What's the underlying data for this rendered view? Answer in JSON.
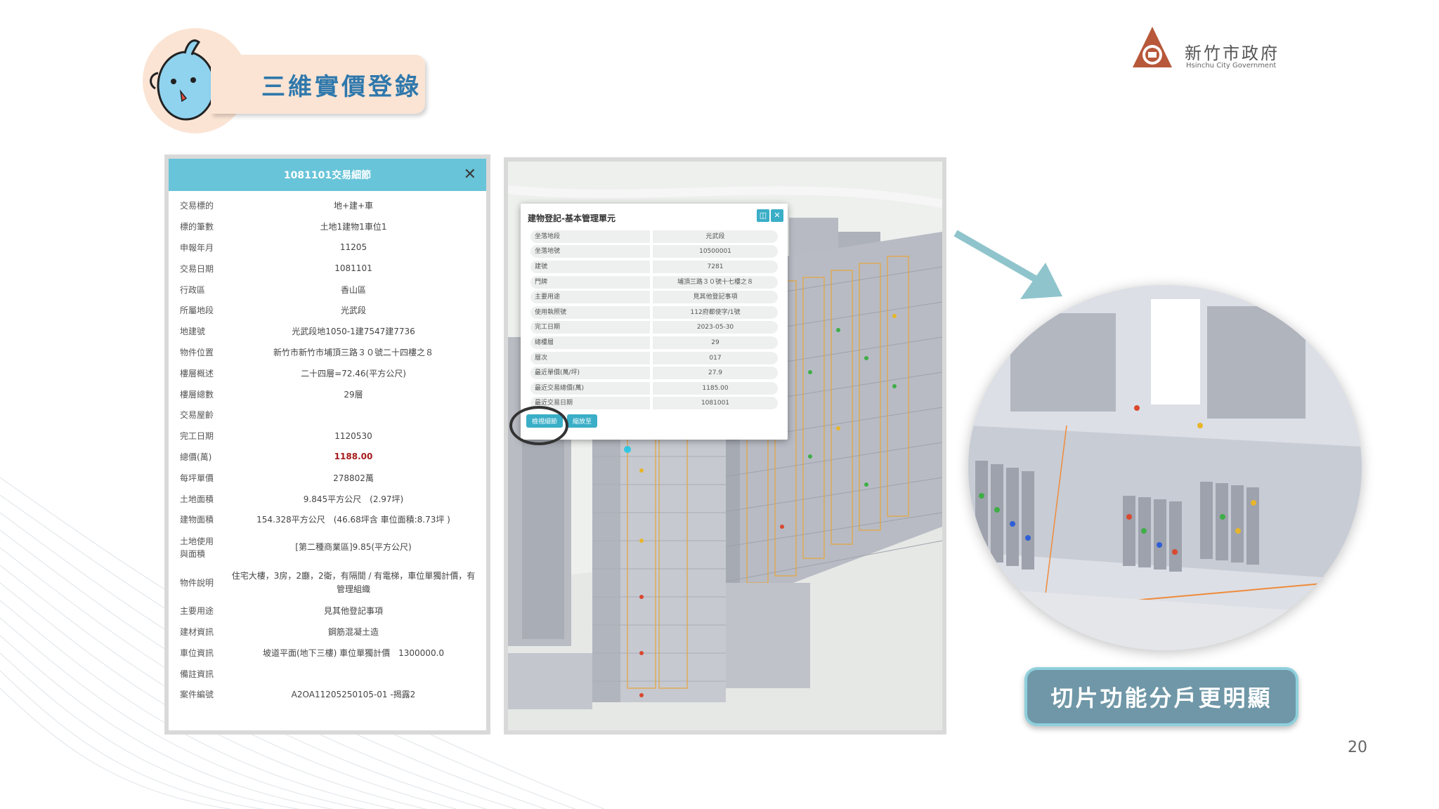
{
  "header": {
    "title": "三維實價登錄",
    "logo_name": "新竹市政府",
    "logo_en": "Hsinchu City Government"
  },
  "detail_panel": {
    "title": "1081101交易細節",
    "rows": [
      {
        "key": "交易標的",
        "value": "地+建+車"
      },
      {
        "key": "標的筆數",
        "value": "土地1建物1車位1"
      },
      {
        "key": "申報年月",
        "value": "11205"
      },
      {
        "key": "交易日期",
        "value": "1081101"
      },
      {
        "key": "行政區",
        "value": "香山區"
      },
      {
        "key": "所屬地段",
        "value": "光武段"
      },
      {
        "key": "地建號",
        "value": "光武段地1050-1建7547建7736"
      },
      {
        "key": "物件位置",
        "value": "新竹市新竹市埔頂三路３０號二十四樓之８"
      },
      {
        "key": "樓層概述",
        "value": "二十四層=72.46(平方公尺)"
      },
      {
        "key": "樓層總數",
        "value": "29層"
      },
      {
        "key": "交易屋齡",
        "value": ""
      },
      {
        "key": "完工日期",
        "value": "1120530"
      },
      {
        "key": "總價(萬)",
        "value": "1188.00"
      },
      {
        "key": "每坪單價",
        "value": "278802萬"
      },
      {
        "key": "土地面積",
        "value": "9.845平方公尺　(2.97坪)"
      },
      {
        "key": "建物面積",
        "value": "154.328平方公尺　(46.68坪含 車位面積:8.73坪 )"
      },
      {
        "key": "土地使用\n與面積",
        "value": "[第二種商業區]9.85(平方公尺)"
      },
      {
        "key": "物件說明",
        "value": "住宅大樓，3房，2廳，2衛，有隔間 / 有電梯，車位單獨計價，有管理組織"
      },
      {
        "key": "主要用途",
        "value": "見其他登記事項"
      },
      {
        "key": "建材資訊",
        "value": "鋼筋混凝土造"
      },
      {
        "key": "車位資訊",
        "value": "坡道平面(地下三樓) 車位單獨計價　1300000.0"
      },
      {
        "key": "備註資訊",
        "value": ""
      },
      {
        "key": "案件編號",
        "value": "A2OA11205250105-01 -揭露2"
      }
    ]
  },
  "popup": {
    "title": "建物登記-基本管理單元",
    "rows": [
      {
        "key": "坐落地段",
        "value": "光武段"
      },
      {
        "key": "坐落地號",
        "value": "10500001"
      },
      {
        "key": "建號",
        "value": "7281"
      },
      {
        "key": "門牌",
        "value": "埔頂三路３０號十七樓之８"
      },
      {
        "key": "主要用途",
        "value": "見其他登記事項"
      },
      {
        "key": "使用執照號",
        "value": "112府都使字/1號"
      },
      {
        "key": "完工日期",
        "value": "2023-05-30"
      },
      {
        "key": "總樓層",
        "value": "29"
      },
      {
        "key": "層次",
        "value": "017"
      },
      {
        "key": "最近單價(萬/坪)",
        "value": "27.9"
      },
      {
        "key": "最近交易總價(萬)",
        "value": "1185.00"
      },
      {
        "key": "最近交易日期",
        "value": "1081001"
      }
    ],
    "btn_detail": "檢視細節",
    "btn_zoom": "縮放至"
  },
  "caption": "切片功能分戶更明顯",
  "page_number": "20"
}
